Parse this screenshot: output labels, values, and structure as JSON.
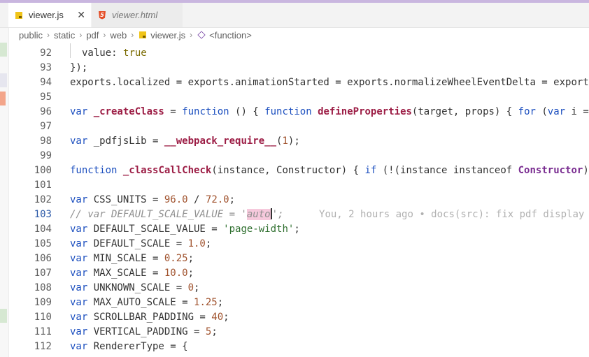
{
  "tabs": [
    {
      "label": "viewer.js",
      "icon": "javascript-file-icon",
      "close": "✕",
      "active": true
    },
    {
      "label": "viewer.html",
      "icon": "html5-file-icon",
      "active": false
    }
  ],
  "html5_glyph": "5",
  "breadcrumb": {
    "items": [
      "public",
      "static",
      "pdf",
      "web",
      "viewer.js",
      "<function>"
    ],
    "separator": "›"
  },
  "editor": {
    "current_line": 103,
    "lines": [
      {
        "n": "92",
        "tokens": [
          {
            "t": "value: "
          },
          {
            "t": "true",
            "c": "val"
          }
        ]
      },
      {
        "n": "93",
        "tokens": [
          {
            "t": "});"
          }
        ]
      },
      {
        "n": "94",
        "tokens": [
          {
            "t": "exports.localized = exports.animationStarted = exports.normalizeWheelEventDelta = export"
          }
        ]
      },
      {
        "n": "95",
        "tokens": []
      },
      {
        "n": "96",
        "tokens": [
          {
            "t": "var ",
            "c": "kw"
          },
          {
            "t": "_createClass",
            "c": "fn"
          },
          {
            "t": " = "
          },
          {
            "t": "function",
            "c": "kw"
          },
          {
            "t": " () { "
          },
          {
            "t": "function",
            "c": "kw"
          },
          {
            "t": " "
          },
          {
            "t": "defineProperties",
            "c": "fn"
          },
          {
            "t": "(target, props) { "
          },
          {
            "t": "for",
            "c": "kw"
          },
          {
            "t": " ("
          },
          {
            "t": "var",
            "c": "kw"
          },
          {
            "t": " i ="
          }
        ]
      },
      {
        "n": "97",
        "tokens": []
      },
      {
        "n": "98",
        "tokens": [
          {
            "t": "var ",
            "c": "kw"
          },
          {
            "t": "_pdfjsLib = "
          },
          {
            "t": "__webpack_require__",
            "c": "fn"
          },
          {
            "t": "("
          },
          {
            "t": "1",
            "c": "num"
          },
          {
            "t": ");"
          }
        ]
      },
      {
        "n": "99",
        "tokens": []
      },
      {
        "n": "100",
        "tokens": [
          {
            "t": "function",
            "c": "kw"
          },
          {
            "t": " "
          },
          {
            "t": "_classCallCheck",
            "c": "fn"
          },
          {
            "t": "(instance, Constructor) { "
          },
          {
            "t": "if",
            "c": "kw"
          },
          {
            "t": " (!(instance instanceof "
          },
          {
            "t": "Constructor",
            "c": "cls"
          },
          {
            "t": ")"
          }
        ]
      },
      {
        "n": "101",
        "tokens": []
      },
      {
        "n": "102",
        "tokens": [
          {
            "t": "var ",
            "c": "kw"
          },
          {
            "t": "CSS_UNITS = "
          },
          {
            "t": "96.0",
            "c": "num"
          },
          {
            "t": " / "
          },
          {
            "t": "72.0",
            "c": "num"
          },
          {
            "t": ";"
          }
        ]
      },
      {
        "n": "103",
        "tokens": [
          {
            "t": "// var DEFAULT_SCALE_VALUE = '",
            "c": "cmt"
          },
          {
            "t": "auto",
            "c": "cmt hl"
          },
          {
            "t": "",
            "c": "cursor"
          },
          {
            "t": "';",
            "c": "cmt"
          },
          {
            "t": "      You, 2 hours ago • docs(src): fix pdf display",
            "c": "blame"
          }
        ]
      },
      {
        "n": "104",
        "tokens": [
          {
            "t": "var ",
            "c": "kw"
          },
          {
            "t": "DEFAULT_SCALE_VALUE = "
          },
          {
            "t": "'page-width'",
            "c": "str"
          },
          {
            "t": ";"
          }
        ]
      },
      {
        "n": "105",
        "tokens": [
          {
            "t": "var ",
            "c": "kw"
          },
          {
            "t": "DEFAULT_SCALE = "
          },
          {
            "t": "1.0",
            "c": "num"
          },
          {
            "t": ";"
          }
        ]
      },
      {
        "n": "106",
        "tokens": [
          {
            "t": "var ",
            "c": "kw"
          },
          {
            "t": "MIN_SCALE = "
          },
          {
            "t": "0.25",
            "c": "num"
          },
          {
            "t": ";"
          }
        ]
      },
      {
        "n": "107",
        "tokens": [
          {
            "t": "var ",
            "c": "kw"
          },
          {
            "t": "MAX_SCALE = "
          },
          {
            "t": "10.0",
            "c": "num"
          },
          {
            "t": ";"
          }
        ]
      },
      {
        "n": "108",
        "tokens": [
          {
            "t": "var ",
            "c": "kw"
          },
          {
            "t": "UNKNOWN_SCALE = "
          },
          {
            "t": "0",
            "c": "num"
          },
          {
            "t": ";"
          }
        ]
      },
      {
        "n": "109",
        "tokens": [
          {
            "t": "var ",
            "c": "kw"
          },
          {
            "t": "MAX_AUTO_SCALE = "
          },
          {
            "t": "1.25",
            "c": "num"
          },
          {
            "t": ";"
          }
        ]
      },
      {
        "n": "110",
        "tokens": [
          {
            "t": "var ",
            "c": "kw"
          },
          {
            "t": "SCROLLBAR_PADDING = "
          },
          {
            "t": "40",
            "c": "num"
          },
          {
            "t": ";"
          }
        ]
      },
      {
        "n": "111",
        "tokens": [
          {
            "t": "var ",
            "c": "kw"
          },
          {
            "t": "VERTICAL_PADDING = "
          },
          {
            "t": "5",
            "c": "num"
          },
          {
            "t": ";"
          }
        ]
      },
      {
        "n": "112",
        "tokens": [
          {
            "t": "var ",
            "c": "kw"
          },
          {
            "t": "RendererType = {"
          }
        ]
      }
    ]
  },
  "colors": {
    "keyword": "#1c4fbf",
    "function": "#9c1d45",
    "number": "#a0522d",
    "string": "#2f6f2f",
    "comment": "#8f8f8f",
    "highlight": "#f6c9dc",
    "accent_strip": "#c9b6df"
  }
}
